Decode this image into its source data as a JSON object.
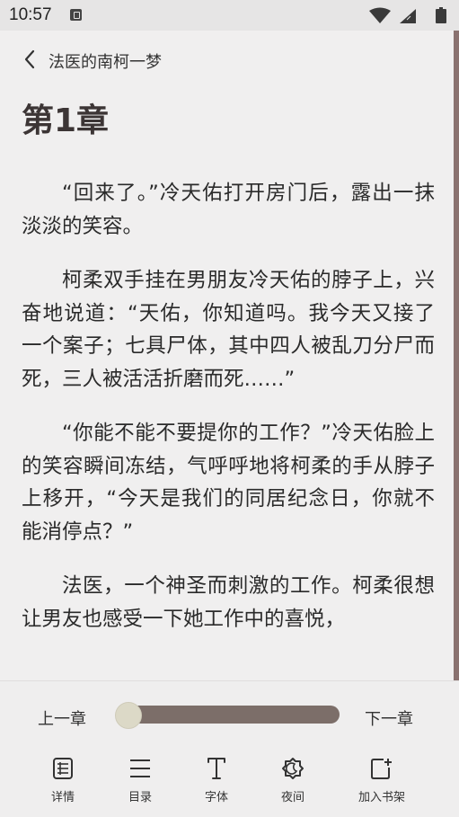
{
  "status_bar": {
    "time": "10:57"
  },
  "header": {
    "title": "法医的南柯一梦"
  },
  "chapter": {
    "title": "第1章"
  },
  "content": {
    "paragraphs": [
      "“回来了。”冷天佑打开房门后，露出一抹淡淡的笑容。",
      "柯柔双手挂在男朋友冷天佑的脖子上，兴奋地说道：“天佑，你知道吗。我今天又接了一个案子；七具尸体，其中四人被乱刀分尸而死，三人被活活折磨而死……”",
      "“你能不能不要提你的工作？”冷天佑脸上的笑容瞬间冻结，气呼呼地将柯柔的手从脖子上移开，“今天是我们的同居纪念日，你就不能消停点？”",
      "法医，一个神圣而刺激的工作。柯柔很想让男友也感受一下她工作中的喜悦，"
    ]
  },
  "navigation": {
    "prev_label": "上一章",
    "next_label": "下一章",
    "progress": 0.0
  },
  "toolbar": {
    "items": [
      {
        "label": "详情",
        "icon": "details-icon"
      },
      {
        "label": "目录",
        "icon": "catalog-icon"
      },
      {
        "label": "字体",
        "icon": "font-icon"
      },
      {
        "label": "夜间",
        "icon": "night-mode-icon"
      },
      {
        "label": "加入书架",
        "icon": "add-bookshelf-icon"
      }
    ]
  }
}
